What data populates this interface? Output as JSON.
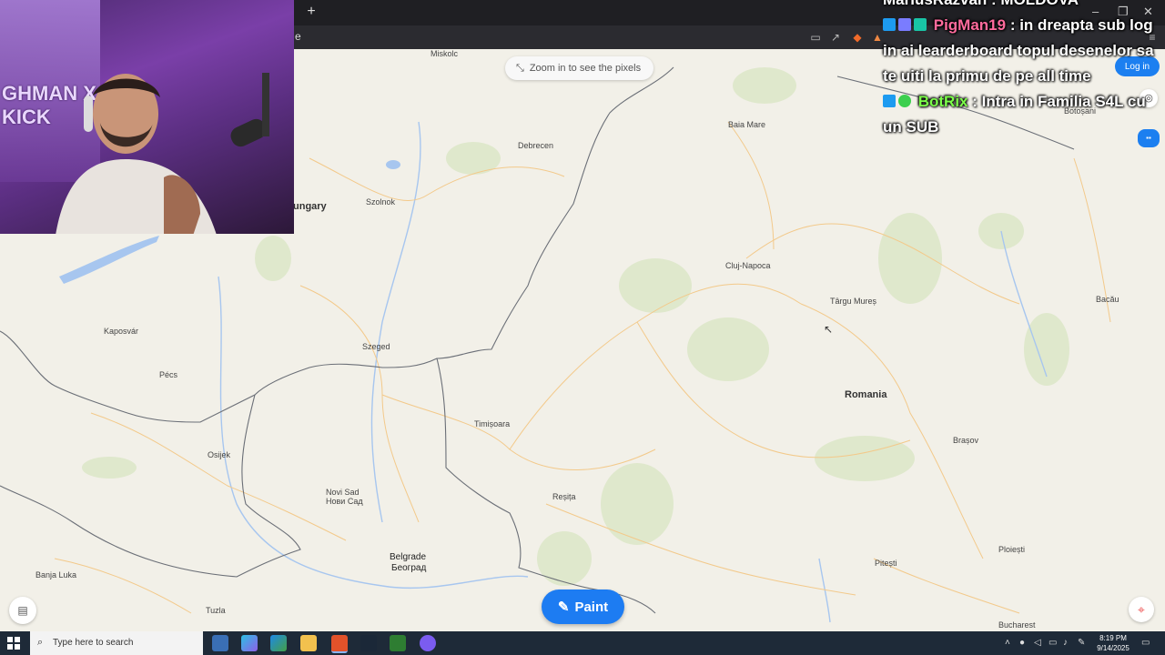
{
  "browser": {
    "new_tab_label": "+",
    "address_fragment": "e",
    "window_min": "–",
    "window_max": "❐",
    "window_close": "✕"
  },
  "map": {
    "zoom_hint": "Zoom in to see the pixels",
    "login_label": "Log in",
    "paint_label": "Paint",
    "countries": {
      "hungary": "ungary",
      "romania": "Romania"
    },
    "cities": {
      "miskolc": "Miskolc",
      "baia_mare": "Baia Mare",
      "botosani": "Botoșani",
      "debrecen": "Debrecen",
      "szolnok": "Szolnok",
      "cluj": "Cluj-Napoca",
      "targu_mures": "Târgu Mureș",
      "bacau": "Bacău",
      "kaposvar": "Kaposvár",
      "szeged": "Szeged",
      "pecs": "Pécs",
      "timisoara": "Timișoara",
      "osijek": "Osijek",
      "brasov": "Brașov",
      "novi_sad": "Novi Sad",
      "novi_sad_cyr": "Нови Сад",
      "resita": "Reșița",
      "belgrade": "Belgrade",
      "belgrade_cyr": "Београд",
      "banja_luka": "Banja Luka",
      "pitesti": "Pitești",
      "ploiesti": "Ploiești",
      "tuzla": "Tuzla",
      "bucharest": "Bucharest"
    }
  },
  "webcam": {
    "poster_text": "GHMAN X KICK"
  },
  "chat": {
    "top_line": "MariusRazvan : MOLDOVA",
    "messages": [
      {
        "user": "PigMan19",
        "user_color": "#ff6b9d",
        "text": ": in dreapta sub log in ai learderboard topul desenelor sa te uiti la primu de pe all time"
      },
      {
        "user": "BotRix",
        "user_color": "#7cff4a",
        "text": ": Intra in Familia S4L cu un SUB"
      }
    ]
  },
  "taskbar": {
    "search_placeholder": "Type here to search",
    "time": "8:19 PM",
    "date": "9/14/2025"
  },
  "colors": {
    "accent": "#1d7cf2",
    "taskbar": "#1e2a38",
    "map_bg": "#f2f0e8"
  }
}
